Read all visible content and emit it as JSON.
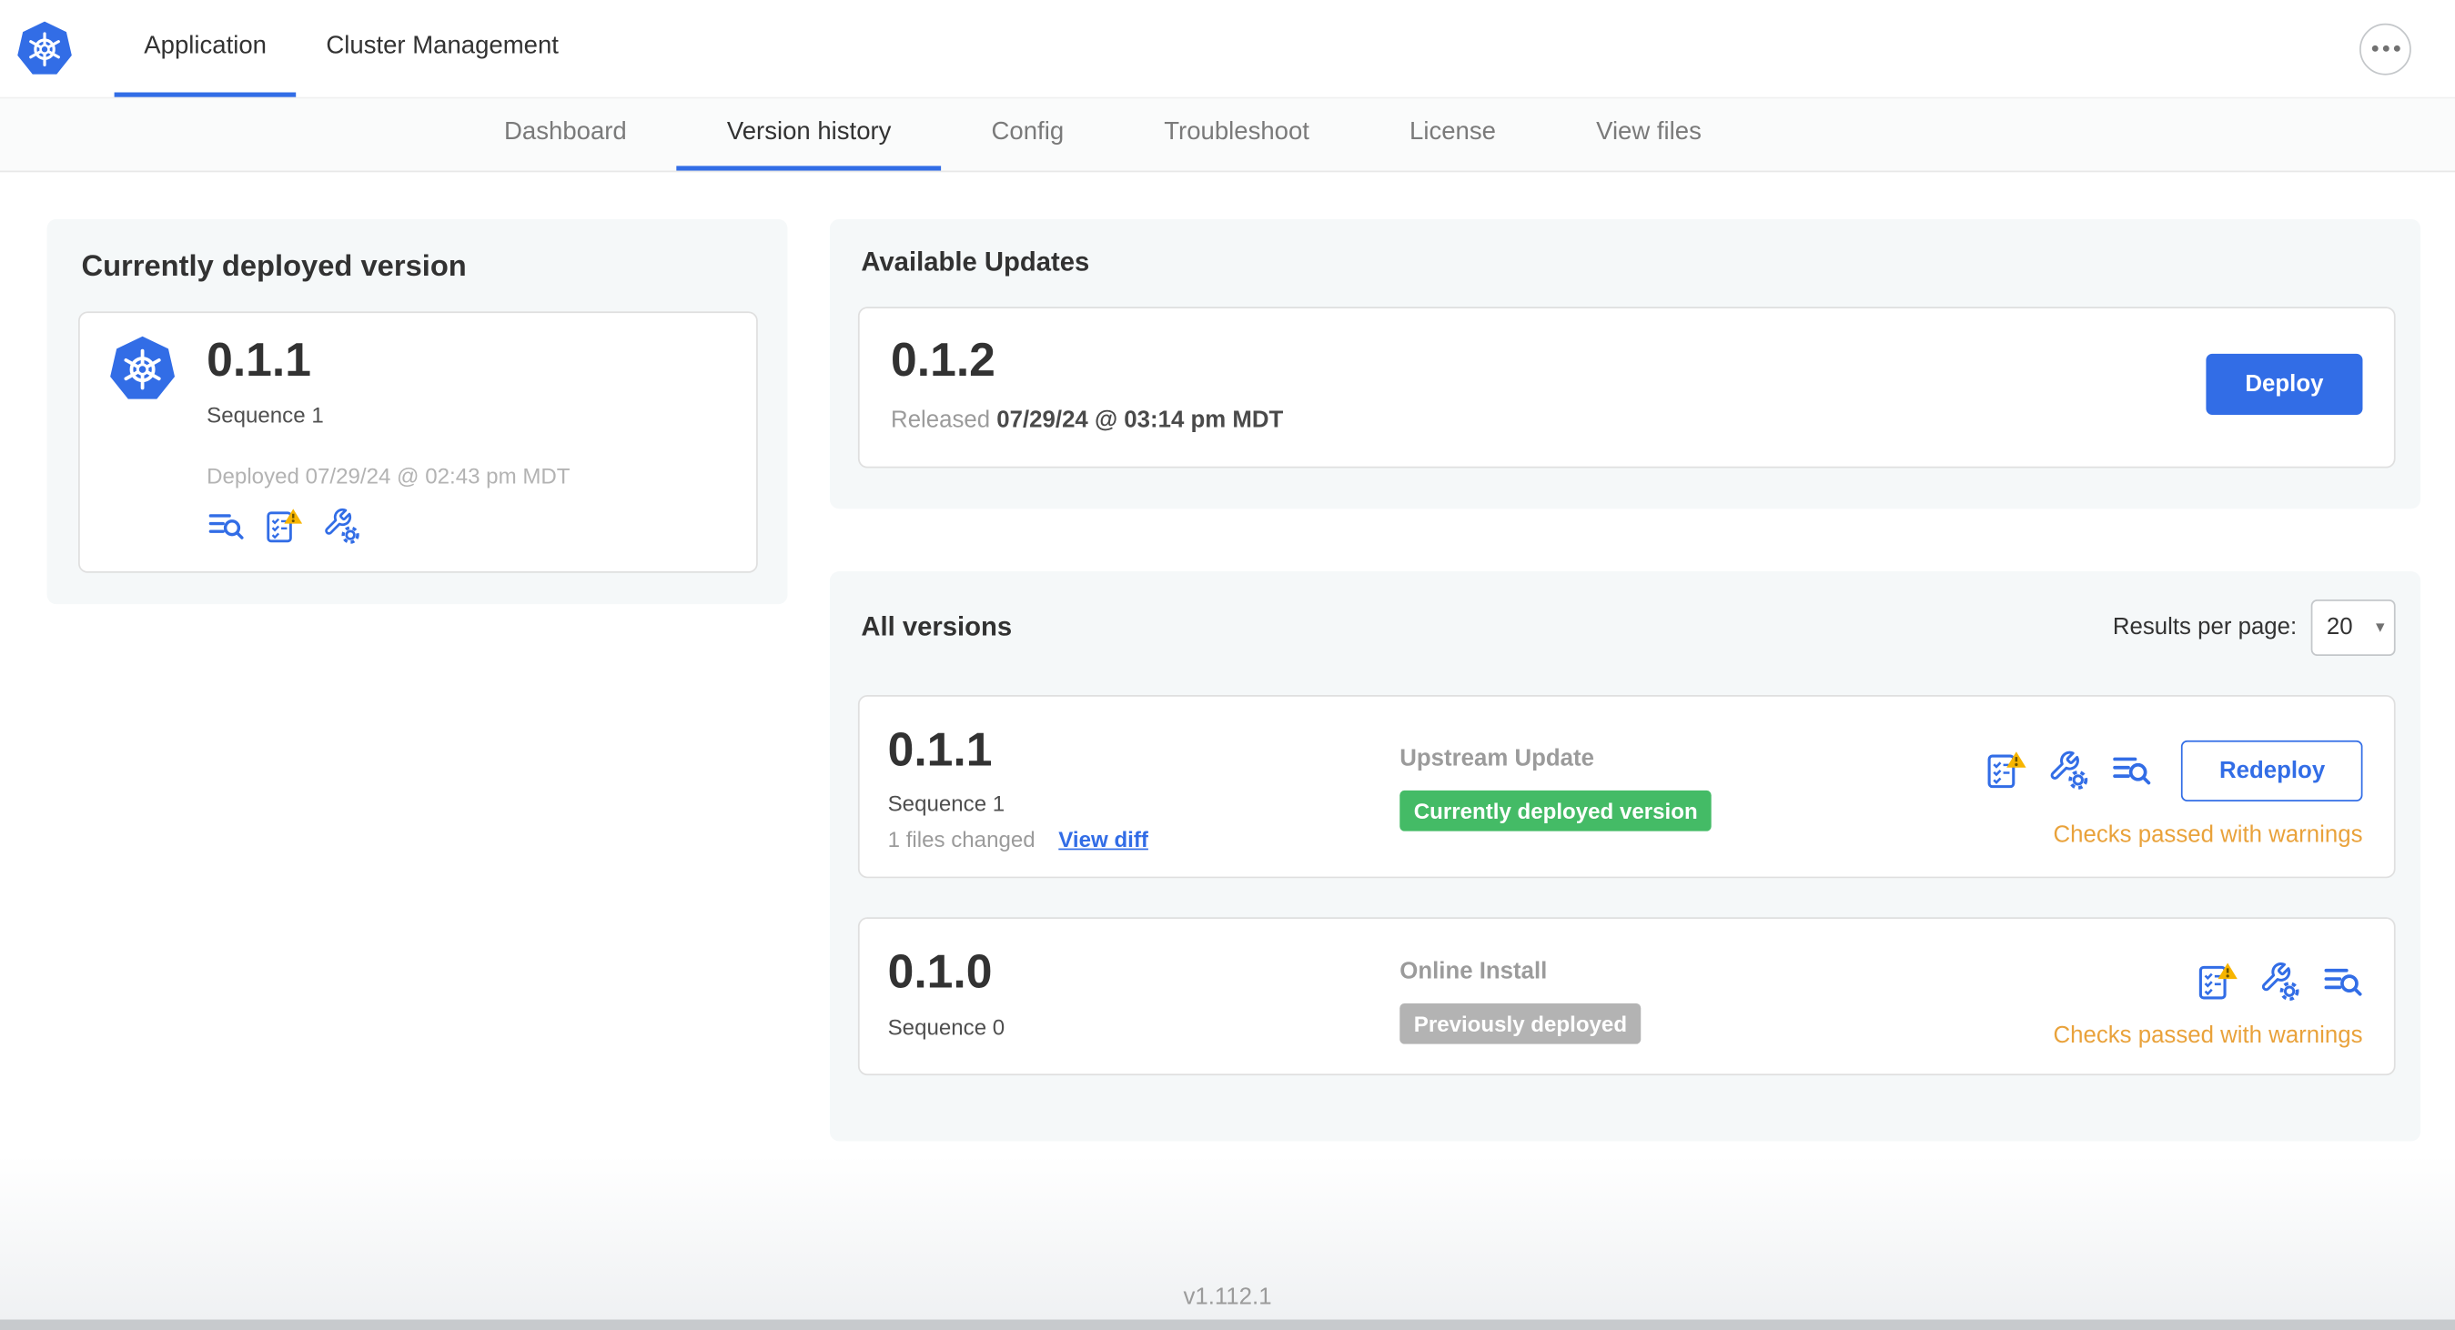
{
  "colors": {
    "accent_blue": "#326de6",
    "card_bg": "#f5f8f9",
    "green_badge": "#44bb66",
    "gray_badge": "#b3b3b3",
    "warning_orange": "#e9a23b",
    "warning_yellow": "#f7b500"
  },
  "icons": {
    "select_chevron": "▾",
    "kubernetes_logo": "heptagon-with-helm-wheel",
    "ellipsis_menu": "three-dots-in-circle",
    "diff": "text-lines-with-magnifier",
    "preflight_checks_warning": "checklist-with-warning-triangle",
    "config": "wrench-with-gear"
  },
  "top_nav": {
    "tabs": [
      {
        "label": "Application",
        "active": true
      },
      {
        "label": "Cluster Management",
        "active": false
      }
    ]
  },
  "sub_nav": {
    "tabs": [
      {
        "label": "Dashboard",
        "active": false
      },
      {
        "label": "Version history",
        "active": true
      },
      {
        "label": "Config",
        "active": false
      },
      {
        "label": "Troubleshoot",
        "active": false
      },
      {
        "label": "License",
        "active": false
      },
      {
        "label": "View files",
        "active": false
      }
    ]
  },
  "current_version_card": {
    "title": "Currently deployed version",
    "version": "0.1.1",
    "sequence": "Sequence 1",
    "deployed": "Deployed 07/29/24 @ 02:43 pm MDT",
    "icons": [
      "diff-icon",
      "preflight-checks-warning-icon",
      "config-icon"
    ]
  },
  "available_updates": {
    "title": "Available Updates",
    "version": "0.1.2",
    "released_prefix": "Released",
    "released_date": "07/29/24 @ 03:14 pm MDT",
    "deploy_button": "Deploy"
  },
  "all_versions": {
    "title": "All versions",
    "results_per_page_label": "Results per page:",
    "results_per_page_value": "20",
    "rows": [
      {
        "version": "0.1.1",
        "sequence": "Sequence 1",
        "files_changed": "1 files changed",
        "view_diff": "View diff",
        "source": "Upstream Update",
        "badge": "Currently deployed version",
        "badge_type": "green",
        "action_button": "Redeploy",
        "checks_text": "Checks passed with warnings",
        "icons": [
          "preflight-checks-warning-icon",
          "config-icon",
          "diff-icon"
        ]
      },
      {
        "version": "0.1.0",
        "sequence": "Sequence 0",
        "source": "Online Install",
        "badge": "Previously deployed",
        "badge_type": "gray",
        "checks_text": "Checks passed with warnings",
        "icons": [
          "preflight-checks-warning-icon",
          "config-icon",
          "diff-icon"
        ]
      }
    ]
  },
  "footer": {
    "version": "v1.112.1"
  }
}
